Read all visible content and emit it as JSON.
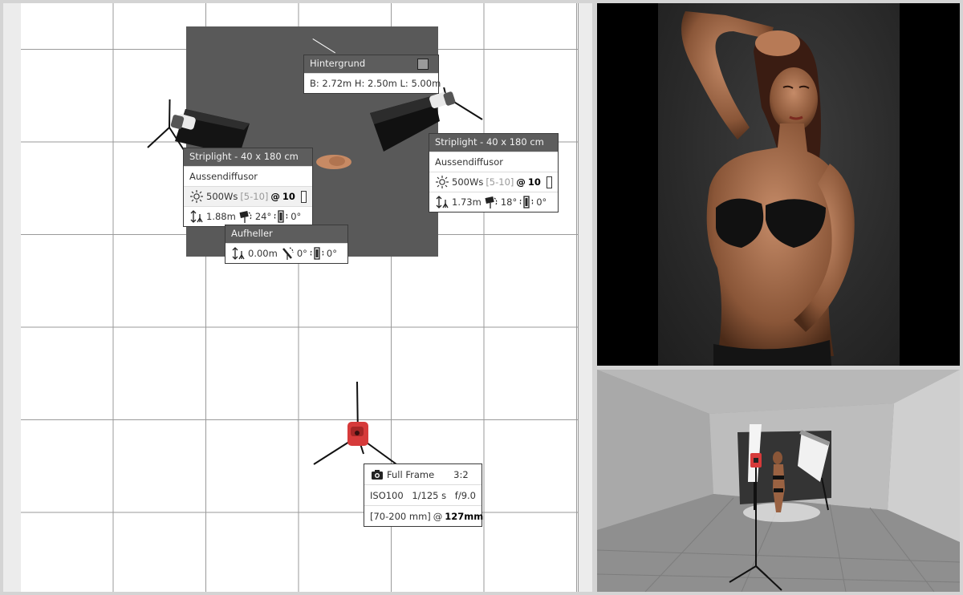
{
  "backdrop": {
    "title": "Hintergrund",
    "dimensions": "B: 2.72m H: 2.50m L: 5.00m"
  },
  "light_left": {
    "title": "Striplight - 40 x 180 cm",
    "modifier": "Aussendiffusor",
    "power": "500Ws",
    "range": "[5-10]",
    "at": "@",
    "setting": "10",
    "height": "1.88m",
    "tilt": "24°",
    "rotation": "0°"
  },
  "light_right": {
    "title": "Striplight - 40 x 180 cm",
    "modifier": "Aussendiffusor",
    "power": "500Ws",
    "range": "[5-10]",
    "at": "@",
    "setting": "10",
    "height": "1.73m",
    "tilt": "18°",
    "rotation": "0°"
  },
  "reflector": {
    "title": "Aufheller",
    "height": "0.00m",
    "tilt": "0°",
    "rotation": "0°"
  },
  "camera": {
    "format": "Full Frame",
    "aspect": "3:2",
    "iso": "ISO100",
    "shutter": "1/125 s",
    "aperture": "f/9.0",
    "lens": "[70-200 mm]",
    "at": "@",
    "focal": "127mm"
  },
  "colors": {
    "panel_header": "#5d5d5d",
    "backdrop": "#595959",
    "camera": "#d63a3a",
    "grid_line": "#9a9a9a"
  }
}
